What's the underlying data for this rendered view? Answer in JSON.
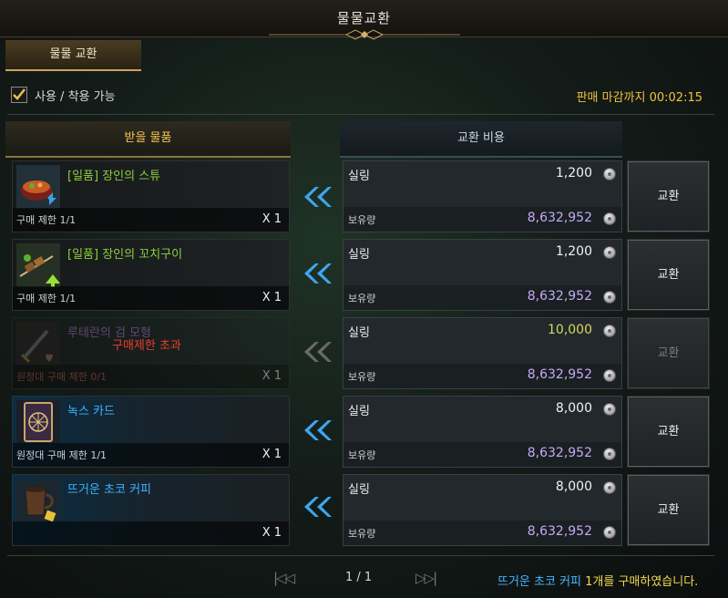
{
  "window": {
    "title": "물물교환"
  },
  "tab": {
    "label": "물물 교환"
  },
  "filter": {
    "label": "사용 / 착용 가능",
    "checked": true
  },
  "deadline": {
    "label": "판매 마감까지",
    "time": "00:02:15"
  },
  "headers": {
    "receive": "받을 물품",
    "cost": "교환 비용"
  },
  "rows": [
    {
      "item_name": "[일품] 장인의 스튜",
      "name_color": "#8ad13c",
      "icon": "stew-icon",
      "limit": "구매 제한 1/1",
      "qty": "X 1",
      "currency": "실링",
      "price": "1,200",
      "own_label": "보유량",
      "own": "8,632,952",
      "button": "교환"
    },
    {
      "item_name": "[일품] 장인의 꼬치구이",
      "name_color": "#8ad13c",
      "icon": "skewer-icon",
      "limit": "구매 제한 1/1",
      "qty": "X 1",
      "currency": "실링",
      "price": "1,200",
      "own_label": "보유량",
      "own": "8,632,952",
      "button": "교환"
    },
    {
      "item_name": "루테란의 검 모형",
      "name_color": "#b87ad6",
      "icon": "sword-icon",
      "limit": "원정대 구매 제한 0/1",
      "qty": "X 1",
      "currency": "실링",
      "price": "10,000",
      "own_label": "보유량",
      "own": "8,632,952",
      "button": "교환",
      "overlay": "구매제한 초과"
    },
    {
      "item_name": "녹스 카드",
      "name_color": "#3fb3ff",
      "icon": "card-icon",
      "limit": "원정대 구매 제한 1/1",
      "qty": "X 1",
      "currency": "실링",
      "price": "8,000",
      "own_label": "보유량",
      "own": "8,632,952",
      "button": "교환"
    },
    {
      "item_name": "뜨거운 초코 커피",
      "name_color": "#3fb3ff",
      "icon": "coffee-mug-icon",
      "limit": "",
      "qty": "X 1",
      "currency": "실링",
      "price": "8,000",
      "own_label": "보유량",
      "own": "8,632,952",
      "button": "교환"
    }
  ],
  "pager": {
    "text": "1 / 1"
  },
  "status": {
    "item": "뜨거운 초코 커피",
    "message": "1개를 구매하였습니다."
  }
}
